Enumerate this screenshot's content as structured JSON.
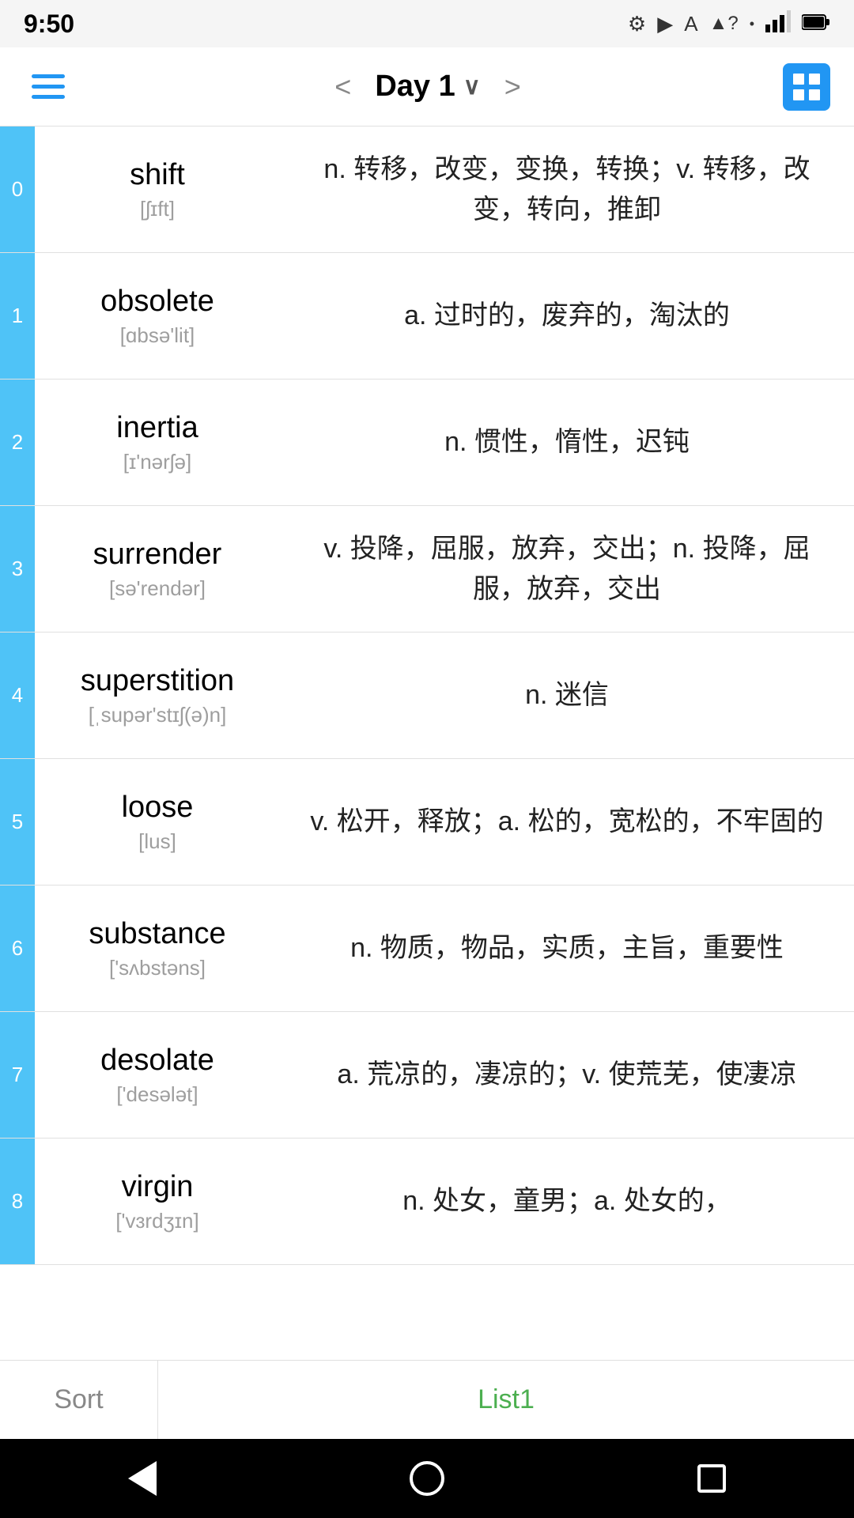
{
  "statusBar": {
    "time": "9:50",
    "icons": [
      "gear",
      "play-protect",
      "font",
      "wifi",
      "signal",
      "battery"
    ]
  },
  "navBar": {
    "prevArrow": "<",
    "nextArrow": ">",
    "title": "Day 1",
    "chevron": "∨"
  },
  "words": [
    {
      "index": "0",
      "english": "shift",
      "phonetic": "[ʃɪft]",
      "definition": "n. 转移，改变，变换，转换；v. 转移，改变，转向，推卸"
    },
    {
      "index": "1",
      "english": "obsolete",
      "phonetic": "[ɑbsə'lit]",
      "definition": "a. 过时的，废弃的，淘汰的"
    },
    {
      "index": "2",
      "english": "inertia",
      "phonetic": "[ɪ'nərʃə]",
      "definition": "n. 惯性，惰性，迟钝"
    },
    {
      "index": "3",
      "english": "surrender",
      "phonetic": "[sə'rendər]",
      "definition": "v. 投降，屈服，放弃，交出；n. 投降，屈服，放弃，交出"
    },
    {
      "index": "4",
      "english": "superstition",
      "phonetic": "[ˌsupər'stɪʃ(ə)n]",
      "definition": "n. 迷信"
    },
    {
      "index": "5",
      "english": "loose",
      "phonetic": "[lus]",
      "definition": "v. 松开，释放；a. 松的，宽松的，不牢固的"
    },
    {
      "index": "6",
      "english": "substance",
      "phonetic": "['sʌbstəns]",
      "definition": "n. 物质，物品，实质，主旨，重要性"
    },
    {
      "index": "7",
      "english": "desolate",
      "phonetic": "['desələt]",
      "definition": "a. 荒凉的，凄凉的；v. 使荒芜，使凄凉"
    },
    {
      "index": "8",
      "english": "virgin",
      "phonetic": "['vɜrdʒɪn]",
      "definition": "n. 处女，童男；a. 处女的，"
    }
  ],
  "bottomTabs": {
    "sort": "Sort",
    "list1": "List1"
  },
  "androidNav": {
    "back": "◀",
    "home": "●",
    "recent": "■"
  }
}
